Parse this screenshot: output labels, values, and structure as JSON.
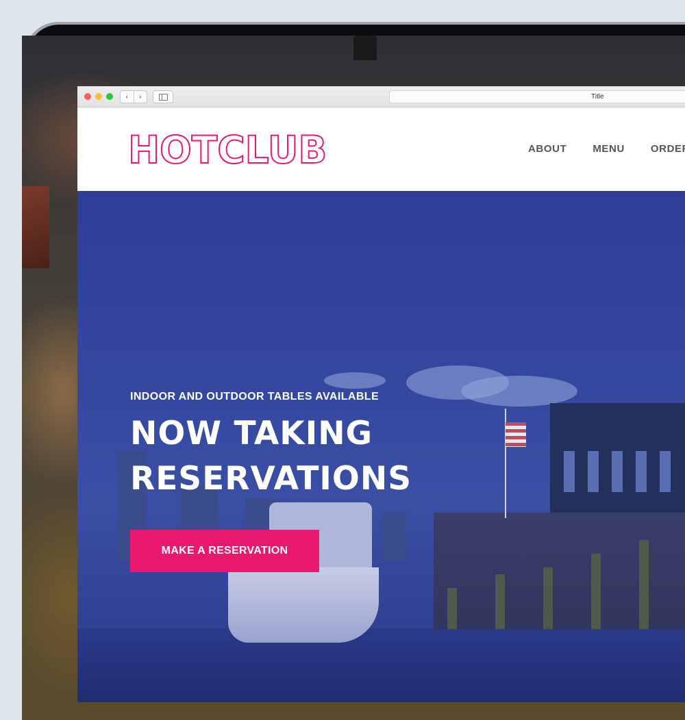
{
  "browser": {
    "title": "Title",
    "back_glyph": "‹",
    "forward_glyph": "›"
  },
  "site": {
    "logo": "HOTCLUB",
    "nav": [
      "ABOUT",
      "MENU",
      "ORDER"
    ]
  },
  "hero": {
    "subtitle": "INDOOR AND OUTDOOR TABLES AVAILABLE",
    "title_line_1": "NOW TAKING",
    "title_line_2": "RESERVATIONS",
    "cta_label": "MAKE A RESERVATION"
  },
  "colors": {
    "accent": "#e8196f",
    "hero_overlay": "#34479f",
    "nav_text": "#555555"
  }
}
